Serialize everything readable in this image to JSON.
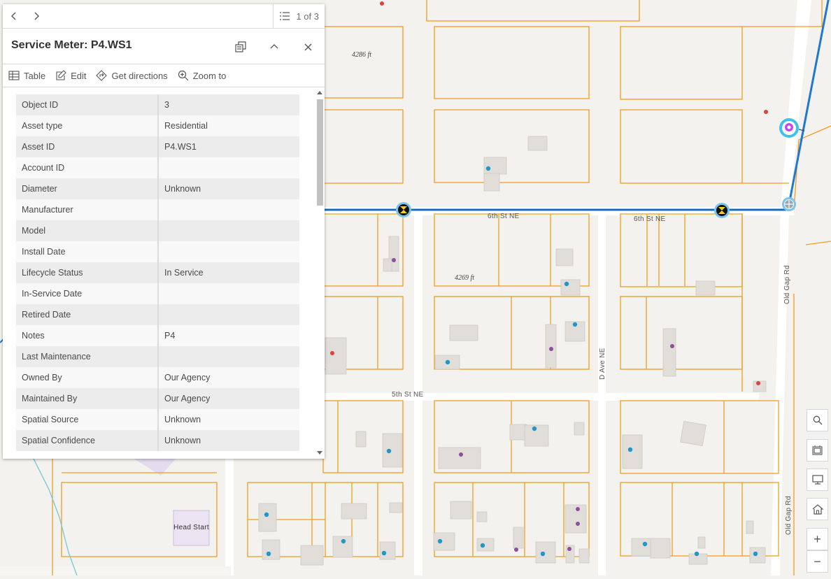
{
  "popup": {
    "pager_text": "1 of 3",
    "title": "Service Meter: P4.WS1",
    "actions": [
      {
        "label": "Table",
        "icon": "table-icon"
      },
      {
        "label": "Edit",
        "icon": "edit-icon"
      },
      {
        "label": "Get directions",
        "icon": "directions-icon"
      },
      {
        "label": "Zoom to",
        "icon": "zoom-to-icon"
      }
    ],
    "attributes": [
      {
        "key": "Object ID",
        "value": "3"
      },
      {
        "key": "Asset type",
        "value": "Residential"
      },
      {
        "key": "Asset ID",
        "value": "P4.WS1"
      },
      {
        "key": "Account ID",
        "value": ""
      },
      {
        "key": "Diameter",
        "value": "Unknown"
      },
      {
        "key": "Manufacturer",
        "value": ""
      },
      {
        "key": "Model",
        "value": ""
      },
      {
        "key": "Install Date",
        "value": ""
      },
      {
        "key": "Lifecycle Status",
        "value": "In Service"
      },
      {
        "key": "In-Service Date",
        "value": ""
      },
      {
        "key": "Retired Date",
        "value": ""
      },
      {
        "key": "Notes",
        "value": "P4"
      },
      {
        "key": "Last Maintenance",
        "value": ""
      },
      {
        "key": "Owned By",
        "value": "Our Agency"
      },
      {
        "key": "Maintained By",
        "value": "Our Agency"
      },
      {
        "key": "Spatial Source",
        "value": "Unknown"
      },
      {
        "key": "Spatial Confidence",
        "value": "Unknown"
      }
    ]
  },
  "map": {
    "street_labels": {
      "sixth_st_1": "6th St NE",
      "sixth_st_2": "6th St NE",
      "fifth_st": "5th St NE",
      "d_ave": "D Ave NE",
      "old_gap_1": "Old Gap Rd",
      "old_gap_2": "Old Gap Rd"
    },
    "elevations": {
      "e1": "4286 ft",
      "e2": "4269 ft"
    },
    "place_label": "Head Start",
    "colors": {
      "parcel": "#f29d1f",
      "water_main": "#1f78d1",
      "meter": "#2196c9",
      "hydrant": "#e04040",
      "other_point": "#8e4ea0"
    }
  },
  "tools": {
    "zoom_in": "+",
    "zoom_out": "−"
  }
}
